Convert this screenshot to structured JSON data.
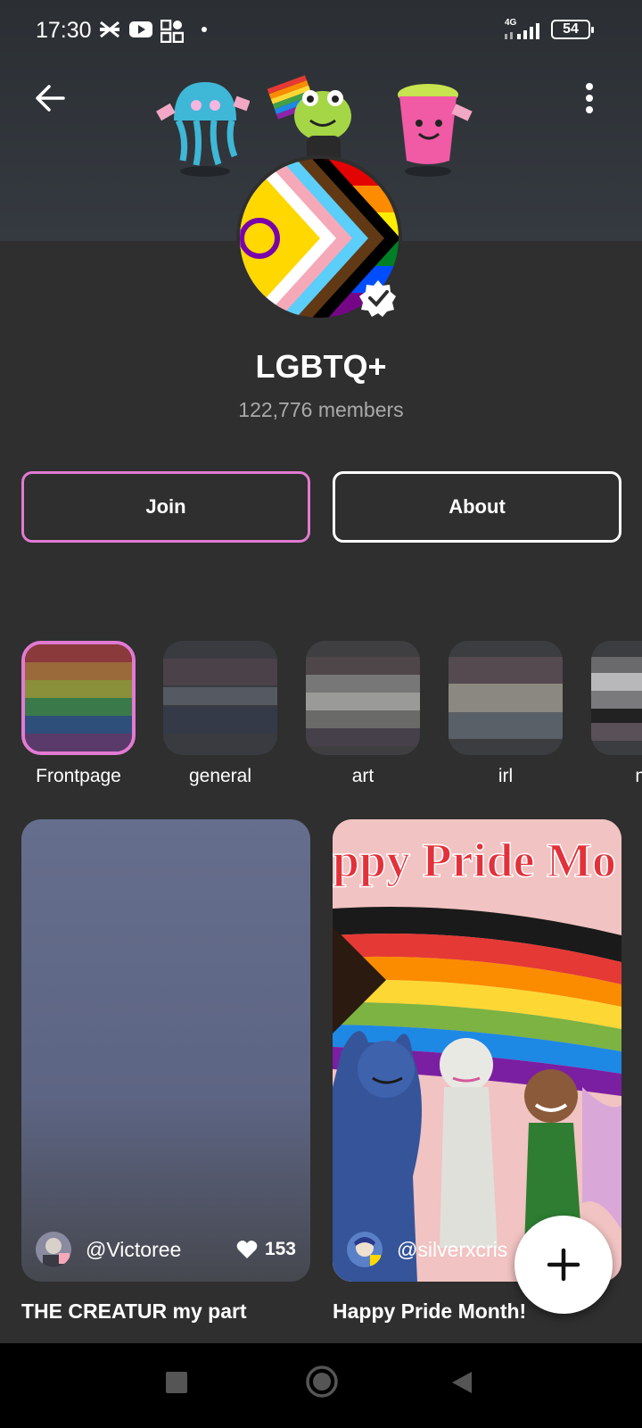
{
  "status_bar": {
    "time": "17:30",
    "network": "4G",
    "battery": "54"
  },
  "community": {
    "name": "LGBTQ+",
    "members": "122,776 members"
  },
  "actions": {
    "join": "Join",
    "about": "About"
  },
  "categories": [
    {
      "label": "Frontpage",
      "selected": true
    },
    {
      "label": "general",
      "selected": false
    },
    {
      "label": "art",
      "selected": false
    },
    {
      "label": "irl",
      "selected": false
    },
    {
      "label": "me",
      "selected": false
    }
  ],
  "posts": [
    {
      "author": "@Victoree",
      "likes": "153",
      "title": "THE CREATUR  my part"
    },
    {
      "author": "@silverxcris",
      "title": "Happy Pride Month!",
      "image_text": "ppy Pride Mo"
    }
  ],
  "colors": {
    "background": "#2e2f2e",
    "accent": "#e27ad3"
  },
  "icons": [
    "back-arrow-icon",
    "more-vertical-icon",
    "verified-badge-icon",
    "heart-icon",
    "plus-icon"
  ]
}
